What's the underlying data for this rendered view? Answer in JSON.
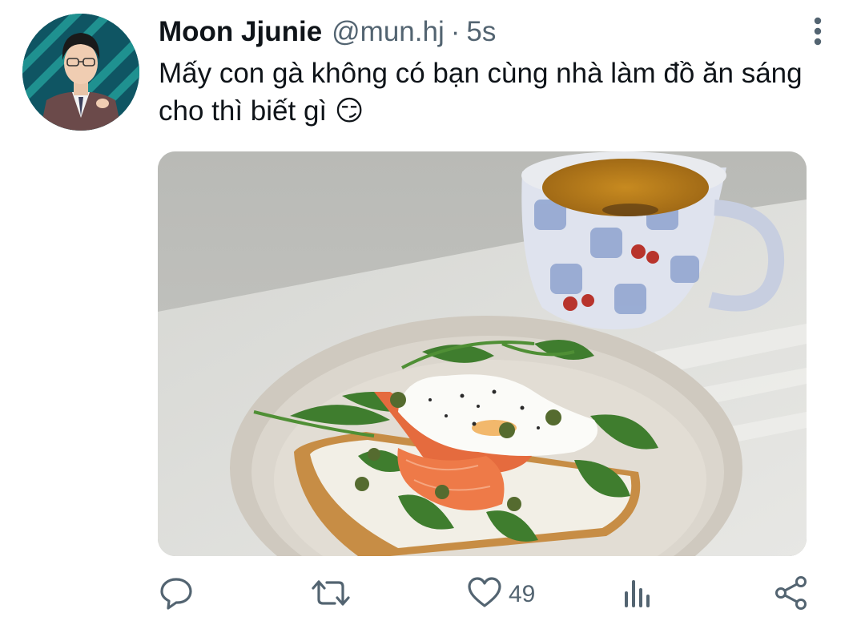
{
  "tweet": {
    "display_name": "Moon Jjunie",
    "handle": "@mun.hj",
    "separator": "·",
    "timestamp": "5s",
    "text": "Mấy con gà không có bạn cùng nhà làm đồ ăn sáng cho thì biết gì 😏"
  },
  "media": {
    "description_icon": "photo"
  },
  "actions": {
    "reply_icon": "reply-icon",
    "retweet_icon": "retweet-icon",
    "like_icon": "heart-icon",
    "like_count": "49",
    "analytics_icon": "analytics-icon",
    "share_icon": "share-icon"
  },
  "colors": {
    "text_primary": "#0f1419",
    "text_secondary": "#536471",
    "background": "#ffffff"
  }
}
